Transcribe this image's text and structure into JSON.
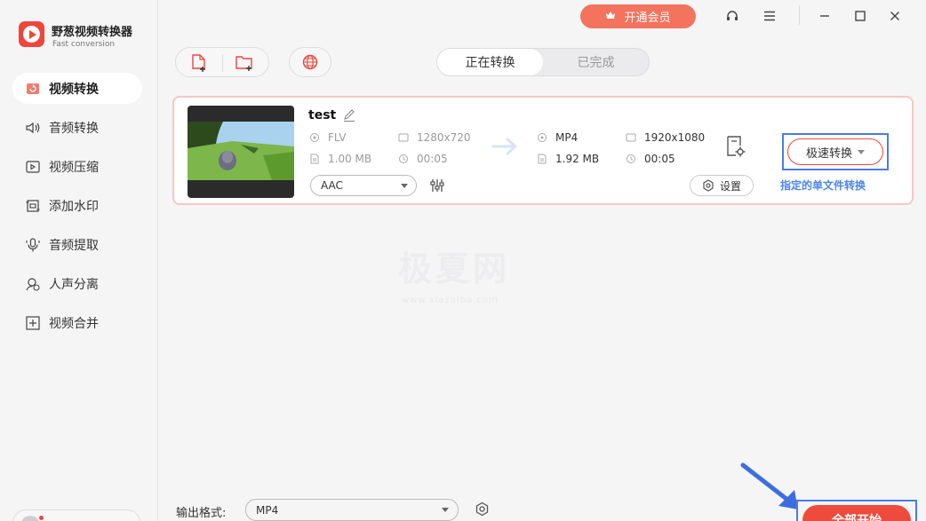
{
  "app": {
    "name": "野葱视频转换器",
    "subtitle": "Fast conversion"
  },
  "sidebar": {
    "items": [
      {
        "label": "视频转换",
        "icon": "video-convert-icon",
        "active": true
      },
      {
        "label": "音频转换",
        "icon": "audio-convert-icon",
        "active": false
      },
      {
        "label": "视频压缩",
        "icon": "video-compress-icon",
        "active": false
      },
      {
        "label": "添加水印",
        "icon": "watermark-icon",
        "active": false
      },
      {
        "label": "音频提取",
        "icon": "audio-extract-icon",
        "active": false
      },
      {
        "label": "人声分离",
        "icon": "vocal-separate-icon",
        "active": false
      },
      {
        "label": "视频合并",
        "icon": "video-merge-icon",
        "active": false
      }
    ]
  },
  "topbar": {
    "vip_label": "开通会员"
  },
  "tabs": [
    {
      "label": "正在转换",
      "active": true
    },
    {
      "label": "已完成",
      "active": false
    }
  ],
  "file": {
    "name": "test",
    "source": {
      "format": "FLV",
      "resolution": "1280x720",
      "size": "1.00 MB",
      "duration": "00:05"
    },
    "target": {
      "format": "MP4",
      "resolution": "1920x1080",
      "size": "1.92 MB",
      "duration": "00:05"
    },
    "audio_codec": "AAC",
    "settings_label": "设置",
    "speed_label": "极速转换",
    "speed_note": "指定的单文件转换"
  },
  "watermark": {
    "text": "极夏网",
    "sub": "www.xiazaiba.com"
  },
  "bottom": {
    "output_label": "输出格式:",
    "output_format": "MP4",
    "start_label": "全部开始"
  },
  "colors": {
    "accent": "#f0453a",
    "vip": "#f4735d",
    "highlight": "#4a7be8",
    "note": "#4a84f0"
  }
}
